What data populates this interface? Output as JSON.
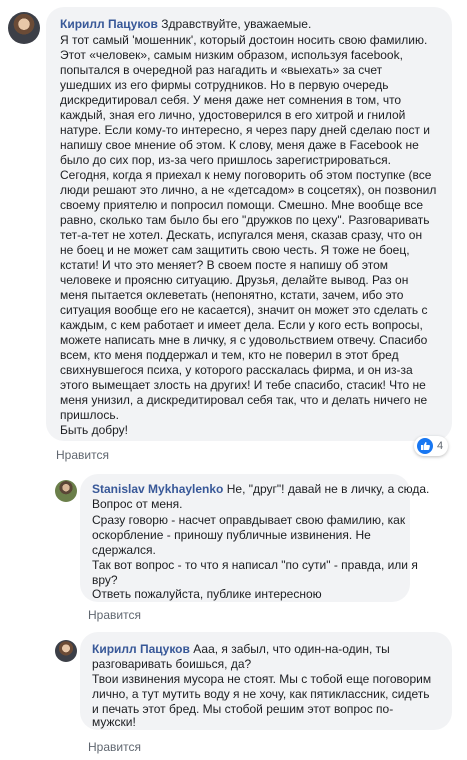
{
  "comment1": {
    "author": "Кирилл Пацуков",
    "lines": [
      "Здравствуйте, уважаемые.",
      "Я тот самый 'мошенник', который достоин носить свою фамилию.",
      "Этот «человек», самым низким образом, используя facebook,",
      "попытался в очередной раз нагадить и «выехать» за счет",
      "ушедших из его фирмы сотрудников. Но в первую очередь",
      "дискредитировал себя. У меня даже нет сомнения в том, что",
      "каждый, зная его лично, удостоверился в его хитрой и гнилой",
      "натуре. Если кому-то интересно, я через пару дней сделаю пост и",
      "напишу свое мнение об этом. К слову, меня даже в Facebook не",
      "было до сих пор, из-за чего пришлось зарегистрироваться.",
      "Сегодня, когда я приехал к нему поговорить об этом поступке (все",
      "люди решают это лично, а не «детсадом» в соцсетях), он позвонил",
      "своему приятелю и попросил помощи. Смешно. Мне вообще все",
      "равно, сколько там было бы его \"дружков по цеху\". Разговаривать",
      "тет-а-тет не хотел. Дескать, испугался меня, сказав сразу, что он",
      "не боец и не может сам защитить свою честь. Я тоже не боец,",
      "кстати! И что это меняет? В своем посте я напишу об этом",
      "человеке и проясню ситуацию. Друзья, делайте вывод. Раз он",
      "меня пытается оклеветать (непонятно, кстати, зачем, ибо это",
      "ситуация вообще его не касается), значит он может это сделать с",
      "каждым, с кем работает и имеет дела. Если у кого есть вопросы,",
      "можете написать мне в личку, я с удовольствием отвечу. Спасибо",
      "всем, кто меня поддержал и тем, кто не поверил в этот бред",
      "свихнувшегося психа, у которого расскалась фирма, и он из-за",
      "этого вымещает злость на других! И тебе спасибо, стасик! Что не",
      "меня унизил, а дискредитировал себя так, что и делать ничего не",
      "пришлось.",
      "Быть добру!"
    ],
    "action": "Нравится",
    "reaction_count": "4"
  },
  "reply1": {
    "author": "Stanislav Mykhaylenko",
    "lines": [
      "Не, \"друг\"! давай не в личку, а сюда.",
      "Вопрос от меня.",
      "Сразу говорю - насчет оправдывает свою фамилию, как",
      "оскорбление - приношу публичные извинения. Не",
      "сдержался.",
      "Так вот вопрос - то что я написал \"по сути\" - правда, или я",
      "вру?",
      "Ответь пожалуйста, публике интересною"
    ],
    "action": "Нравится"
  },
  "reply2": {
    "author": "Кирилл Пацуков",
    "lines": [
      "Ааа, я забыл, что один-на-один, ты",
      "разговаривать боишься, да?",
      "Твои извинения мусора не стоят. Мы с тобой еще поговорим",
      "лично, а тут мутить воду я не хочу, как пятиклассник, сидеть",
      "и печать этот бред. Мы стобой решим этот вопрос по-",
      "мужски!"
    ],
    "action": "Нравится"
  },
  "colors": {
    "bubble": "#f2f3f5",
    "author": "#385898",
    "like": "#1877f2",
    "muted": "#606770"
  },
  "icons": {
    "like": "thumbs-up-icon"
  }
}
